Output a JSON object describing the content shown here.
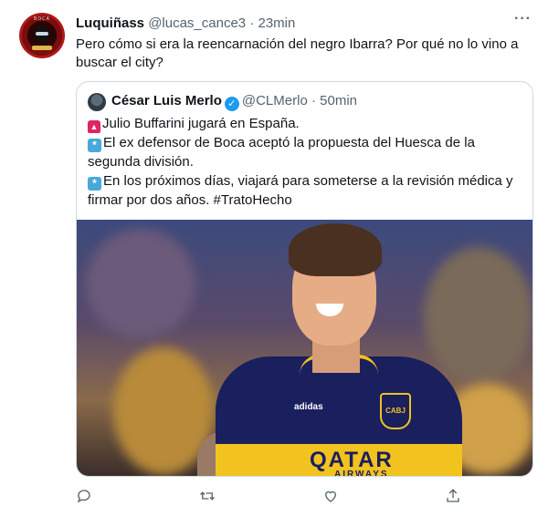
{
  "tweet": {
    "author_name": "Luquiñass",
    "handle": "@lucas_cance3",
    "time": "23min",
    "text": "Pero cómo si era la reencarnación del negro Ibarra? Por qué no lo vino a buscar el city?",
    "avatar_text": "BOCA"
  },
  "quoted": {
    "author_name": "César Luis Merlo",
    "handle": "@CLMerlo",
    "time": "50min",
    "lines": [
      "Julio Buffarini jugará en España.",
      "El ex defensor de Boca aceptó la propuesta del Huesca de la segunda división.",
      "En los próximos días, viajará para someterse a la revisión médica y firmar por dos años. #TratoHecho"
    ],
    "photo": {
      "sponsor": "QATAR",
      "sponsor_sub": "AIRWAYS",
      "badge": "CABJ",
      "brand": "adidas"
    }
  },
  "separators": {
    "dot": "·",
    "more": "···"
  },
  "icons": {
    "more": "more-horizontal-icon",
    "verified": "verified-badge-icon",
    "reply": "reply-icon",
    "retweet": "retweet-icon",
    "like": "like-icon",
    "share": "share-icon"
  },
  "colors": {
    "text": "#0f1419",
    "muted": "#536471",
    "border": "#cfd9de",
    "verified": "#1d9bf0"
  }
}
